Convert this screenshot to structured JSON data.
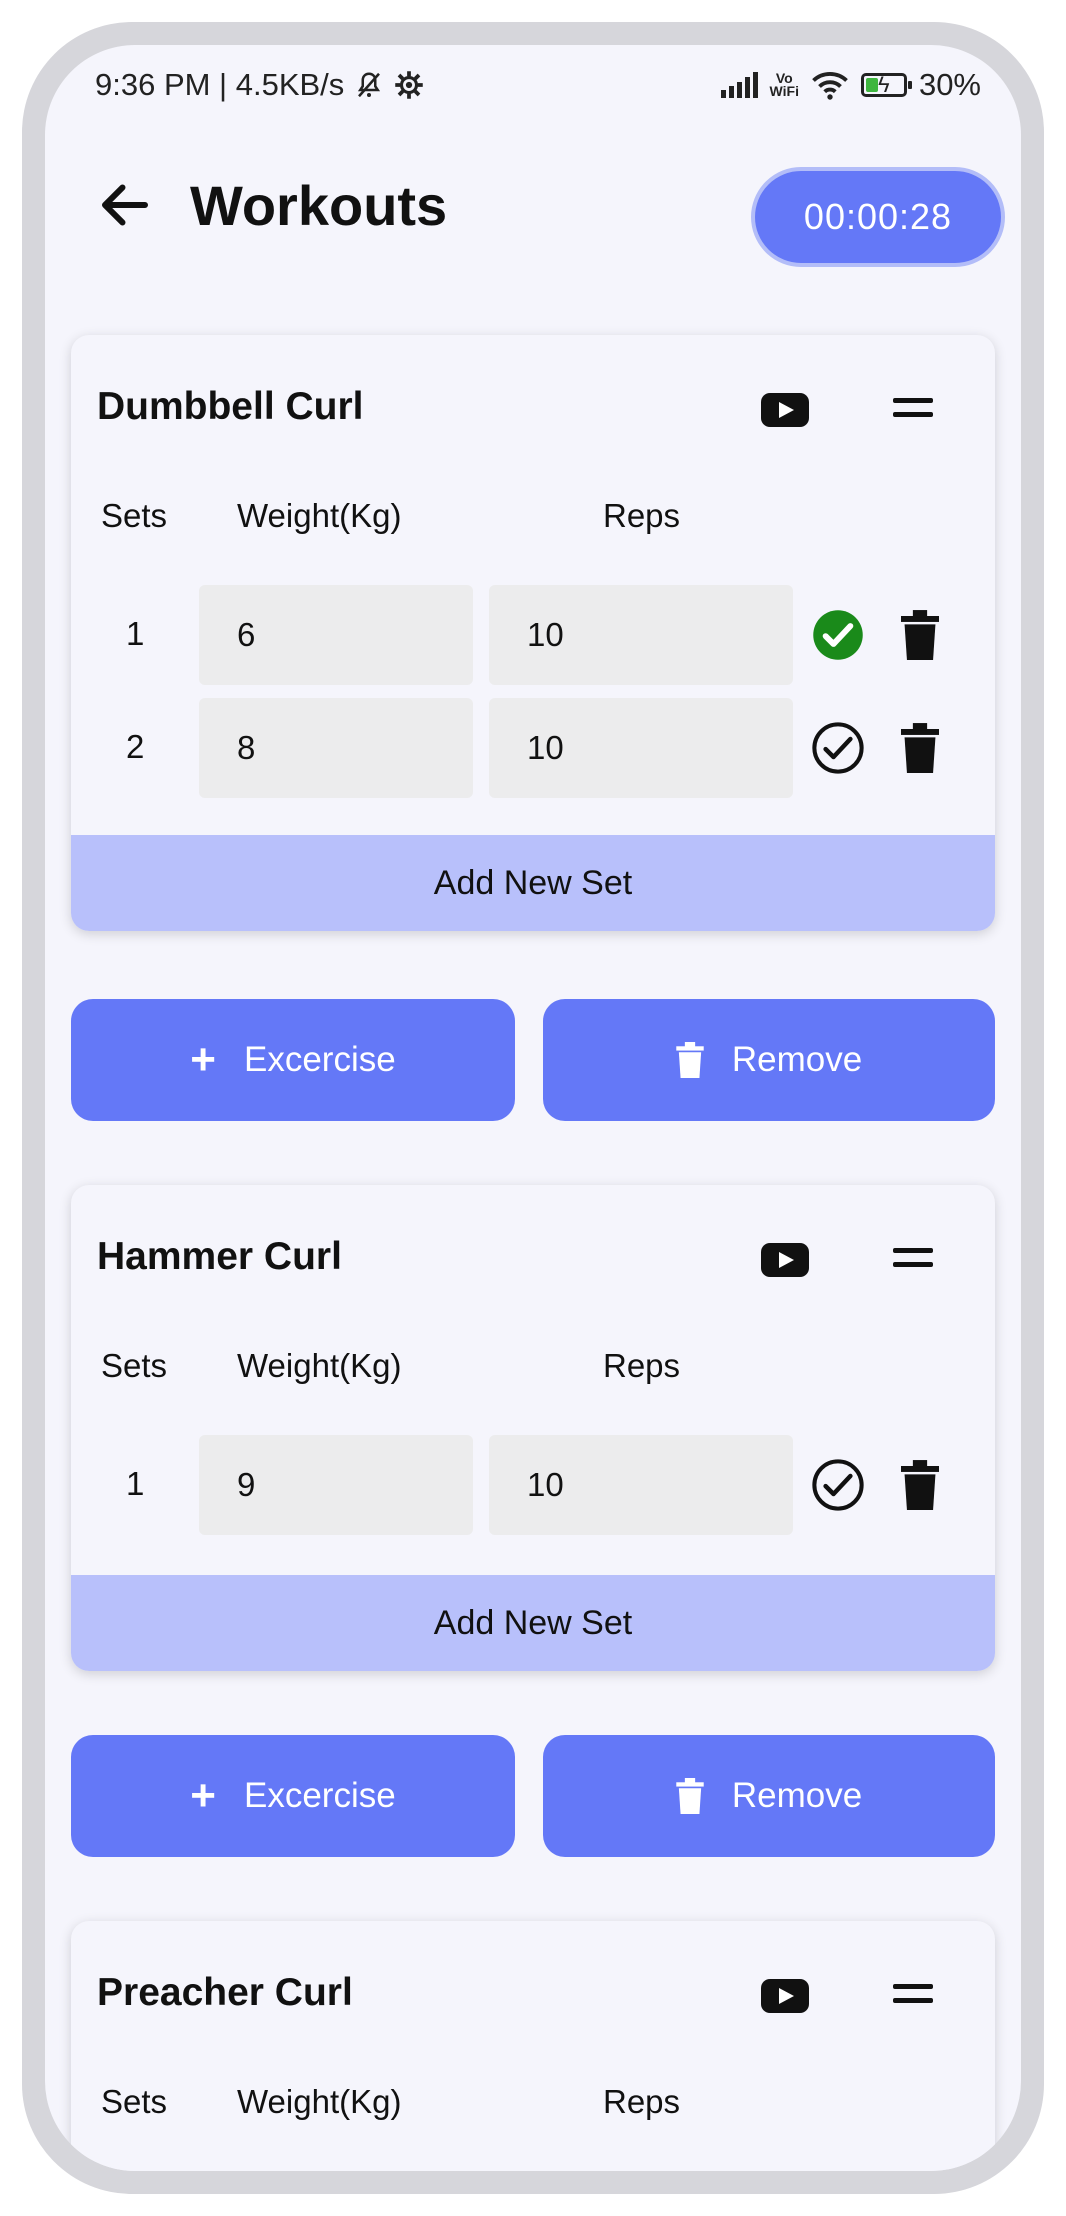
{
  "status_bar": {
    "left_text": "9:36 PM | 4.5KB/s",
    "vowifi_top": "Vo",
    "vowifi_bottom": "WiFi",
    "battery": "30%"
  },
  "header": {
    "title": "Workouts",
    "timer": "00:00:28"
  },
  "table_headers": {
    "sets": "Sets",
    "weight": "Weight(Kg)",
    "reps": "Reps"
  },
  "exercises": [
    {
      "name": "Dumbbell Curl",
      "sets": [
        {
          "num": "1",
          "weight": "6",
          "reps": "10",
          "done": true
        },
        {
          "num": "2",
          "weight": "8",
          "reps": "10",
          "done": false
        }
      ],
      "add_set_label": "Add New Set"
    },
    {
      "name": "Hammer Curl",
      "sets": [
        {
          "num": "1",
          "weight": "9",
          "reps": "10",
          "done": false
        }
      ],
      "add_set_label": "Add New Set"
    },
    {
      "name": "Preacher Curl",
      "sets": []
    }
  ],
  "actions": {
    "exercise_label": "Excercise",
    "remove_label": "Remove"
  },
  "colors": {
    "accent": "#6478f7",
    "add_set_bg": "#b8c0fb",
    "done_green": "#1a8a1a"
  }
}
